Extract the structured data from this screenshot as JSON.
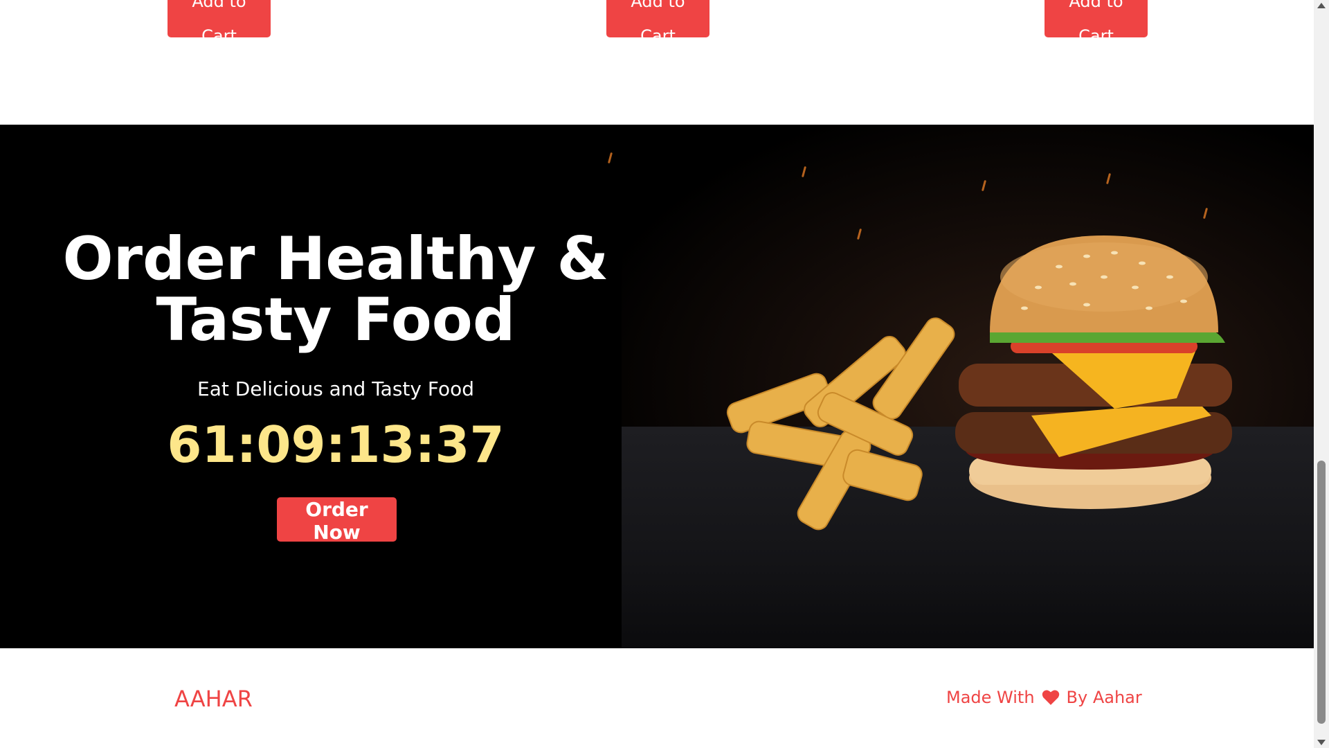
{
  "products": {
    "add_to_cart_labels": [
      "Add to Cart",
      "Add to Cart",
      "Add to Cart"
    ]
  },
  "hero": {
    "title": "Order Healthy & Tasty Food",
    "subtitle": "Eat Delicious and Tasty Food",
    "countdown": "61:09:13:37",
    "order_button": "Order Now",
    "image_icon": "burger-and-fries-image"
  },
  "footer": {
    "brand": "AAHAR",
    "credit_prefix": "Made With",
    "credit_icon": "heart-icon",
    "credit_suffix": "By Aahar"
  },
  "colors": {
    "accent": "#ef4444",
    "countdown": "#fde68a",
    "hero_bg": "#000000"
  }
}
